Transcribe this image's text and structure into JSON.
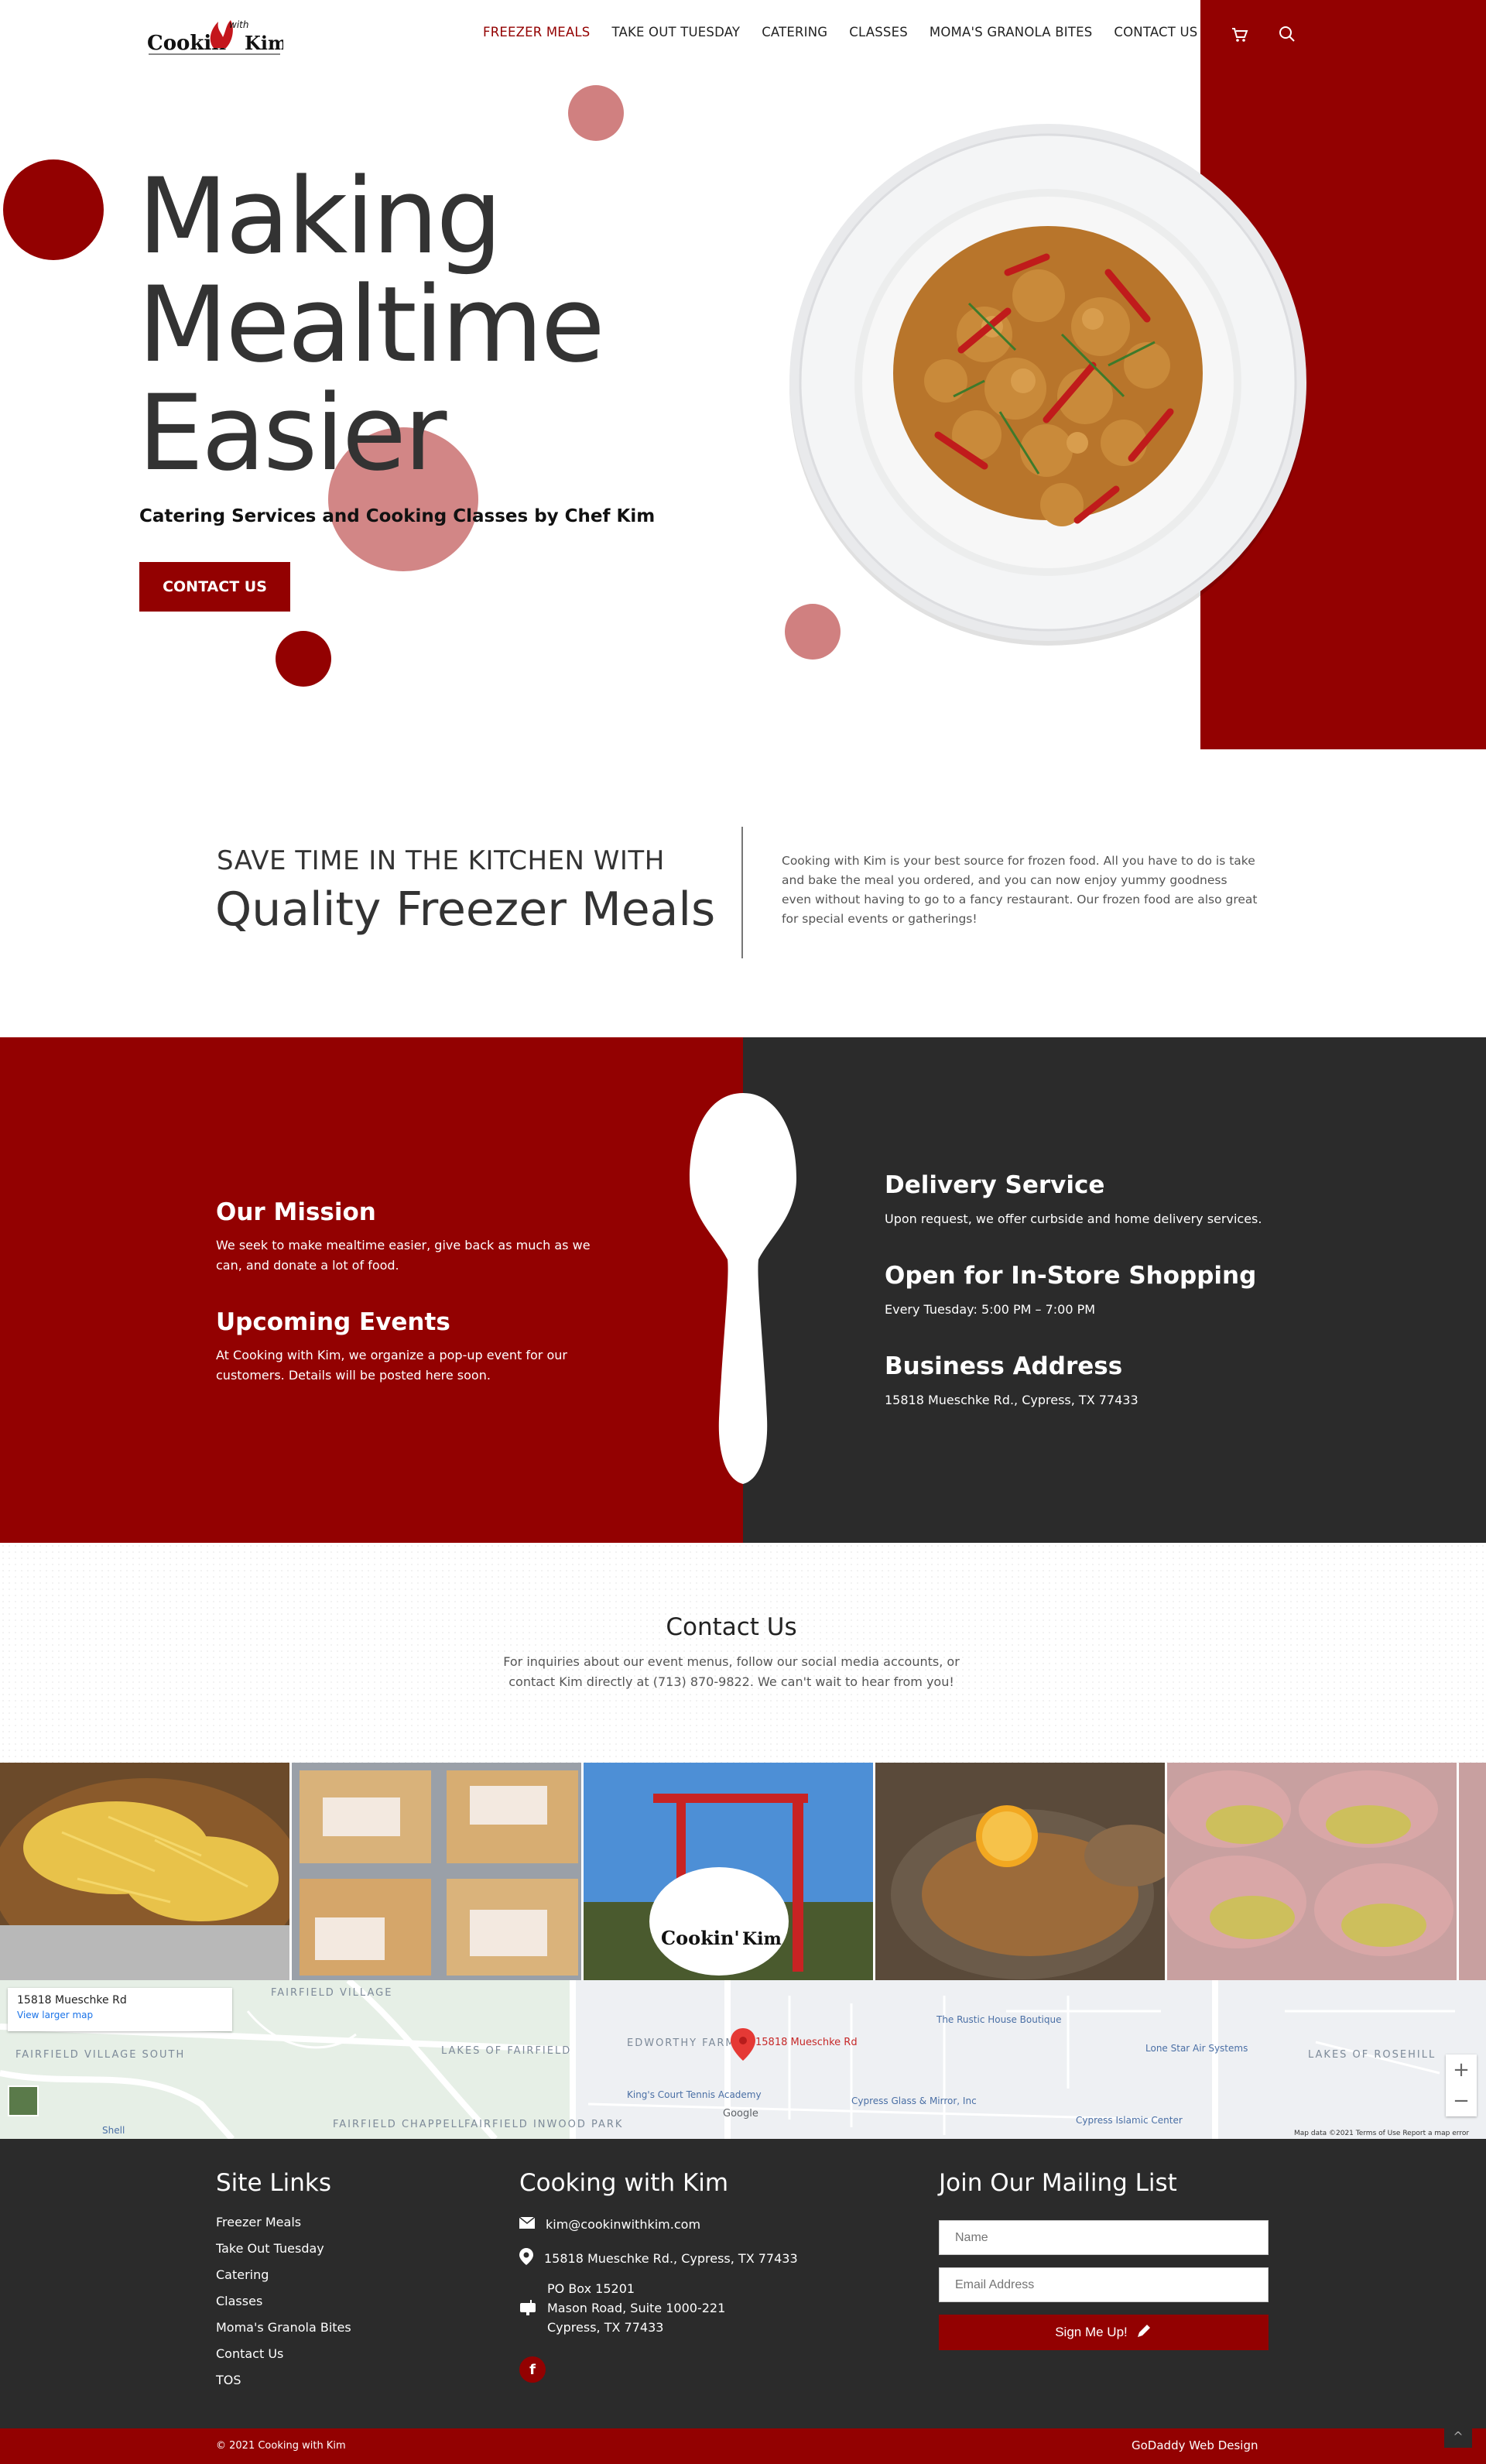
{
  "brand": {
    "logo_main": "Cookin'",
    "logo_with": "with",
    "logo_name": "Kim"
  },
  "nav": {
    "items": [
      "FREEZER MEALS",
      "TAKE OUT TUESDAY",
      "CATERING",
      "CLASSES",
      "MOMA'S GRANOLA BITES",
      "CONTACT US"
    ],
    "active": "FREEZER MEALS"
  },
  "hero": {
    "title_1": "Making",
    "title_2": "Mealtime",
    "title_3": "Easier",
    "subtitle": "Catering Services and Cooking Classes by Chef Kim",
    "button": "CONTACT US"
  },
  "intro": {
    "kicker": "SAVE TIME IN THE KITCHEN WITH",
    "title": "Quality Freezer Meals",
    "text": "Cooking with Kim is your best source for frozen food. All you have to do is take and bake the meal you ordered, and you can now enjoy yummy goodness even without having to go to a fancy restaurant. Our frozen food are also great for special events or gatherings!"
  },
  "info": {
    "mission_title": "Our Mission",
    "mission_text": "We seek to make mealtime easier, give back as much as we can, and donate a lot of food.",
    "events_title": "Upcoming Events",
    "events_text": "At Cooking with Kim, we organize a pop-up event for our customers. Details will be posted here soon.",
    "delivery_title": "Delivery Service",
    "delivery_text": "Upon request, we offer curbside and home delivery services.",
    "shop_title": "Open for In-Store Shopping",
    "shop_text": "Every Tuesday: 5:00 PM – 7:00 PM",
    "address_title": "Business Address",
    "address_text": "15818 Mueschke Rd., Cypress, TX 77433"
  },
  "contact": {
    "title": "Contact Us",
    "text": "For inquiries about our event menus, follow our social media accounts, or contact Kim directly at (713) 870-9822. We can't wait to hear from you!"
  },
  "photos": {
    "sign_text": "Cookin'",
    "sign_name": "Kim"
  },
  "map": {
    "card_title": "15818 Mueschke Rd",
    "card_link": "View larger map",
    "pin_label": "15818 Mueschke Rd",
    "labels": [
      "FAIRFIELD VILLAGE",
      "FAIRFIELD VILLAGE SOUTH",
      "LAKES OF FAIRFIELD",
      "EDWORTHY FARMS",
      "FAIRFIELD CHAPPELL",
      "FAIRFIELD INWOOD PARK",
      "LAKES OF ROSEHILL"
    ],
    "poi": [
      "The Rustic House Boutique",
      "Lone Star Air Systems",
      "King's Court Tennis Academy",
      "Cypress Glass & Mirror, Inc",
      "Cypress Islamic Center",
      "Shell"
    ],
    "footer": "Map data ©2021   Terms of Use   Report a map error",
    "google": "Google",
    "zoom_in": "+",
    "zoom_out": "−"
  },
  "footer": {
    "links_title": "Site Links",
    "links": [
      "Freezer Meals",
      "Take Out Tuesday",
      "Catering",
      "Classes",
      "Moma's Granola Bites",
      "Contact Us",
      "TOS"
    ],
    "company_title": "Cooking with Kim",
    "email": "kim@cookinwithkim.com",
    "address": "15818 Mueschke Rd., Cypress, TX 77433",
    "po_1": "PO Box 15201",
    "po_2": "Mason Road, Suite 1000-221",
    "po_3": "Cypress, TX 77433",
    "fb": "f",
    "mail_title": "Join Our Mailing List",
    "name_ph": "Name",
    "email_ph": "Email Address",
    "signup": "Sign Me Up!"
  },
  "bottom": {
    "copyright": "© 2021 Cooking with Kim",
    "credit": "GoDaddy Web Design",
    "up": "^"
  },
  "colors": {
    "accent": "#930101",
    "dark": "#2b2b2b",
    "pink": "#d07f7f"
  }
}
